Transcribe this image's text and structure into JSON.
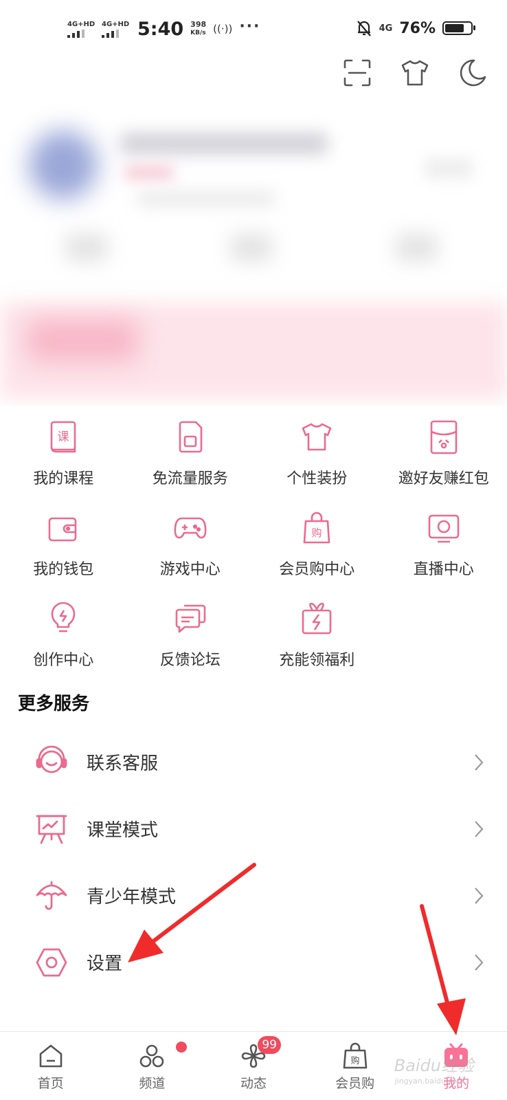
{
  "status_bar": {
    "sim1_label": "4G+HD",
    "sim2_label": "4G+HD",
    "time": "5:40",
    "speed_value": "398",
    "speed_unit": "KB/s",
    "nfc_text": "((·))",
    "more_dots": "···",
    "network": "4G",
    "battery_percent": "76%",
    "battery_level": 0.76
  },
  "top_actions": [
    {
      "name": "scan-icon"
    },
    {
      "name": "shirt-icon"
    },
    {
      "name": "moon-icon"
    }
  ],
  "accent_color": "#fb7299",
  "arrow_color": "#f02b2b",
  "grid": [
    {
      "label": "我的课程",
      "icon": "course-book-icon"
    },
    {
      "label": "免流量服务",
      "icon": "sim-card-icon"
    },
    {
      "label": "个性装扮",
      "icon": "tshirt-icon"
    },
    {
      "label": "邀好友赚红包",
      "icon": "red-envelope-icon"
    },
    {
      "label": "我的钱包",
      "icon": "wallet-icon"
    },
    {
      "label": "游戏中心",
      "icon": "gamepad-icon"
    },
    {
      "label": "会员购中心",
      "icon": "shopping-bag-icon"
    },
    {
      "label": "直播中心",
      "icon": "tv-icon"
    },
    {
      "label": "创作中心",
      "icon": "lightbulb-icon"
    },
    {
      "label": "反馈论坛",
      "icon": "chat-bubbles-icon"
    },
    {
      "label": "充能领福利",
      "icon": "gift-box-icon"
    }
  ],
  "more_services": {
    "title": "更多服务",
    "items": [
      {
        "label": "联系客服",
        "icon": "headset-icon"
      },
      {
        "label": "课堂模式",
        "icon": "classroom-board-icon"
      },
      {
        "label": "青少年模式",
        "icon": "umbrella-icon"
      },
      {
        "label": "设置",
        "icon": "settings-hex-icon"
      }
    ]
  },
  "bottom_nav": [
    {
      "label": "首页",
      "icon": "home-icon"
    },
    {
      "label": "频道",
      "icon": "channel-icon",
      "badge_dot": true
    },
    {
      "label": "动态",
      "icon": "pinwheel-icon",
      "badge": "99"
    },
    {
      "label": "会员购",
      "icon": "shopping-bag-icon"
    },
    {
      "label": "我的",
      "icon": "tv-face-icon",
      "active": true
    }
  ],
  "watermark": {
    "text": "Baidu经验",
    "sub": "jingyan.baidu.com"
  }
}
